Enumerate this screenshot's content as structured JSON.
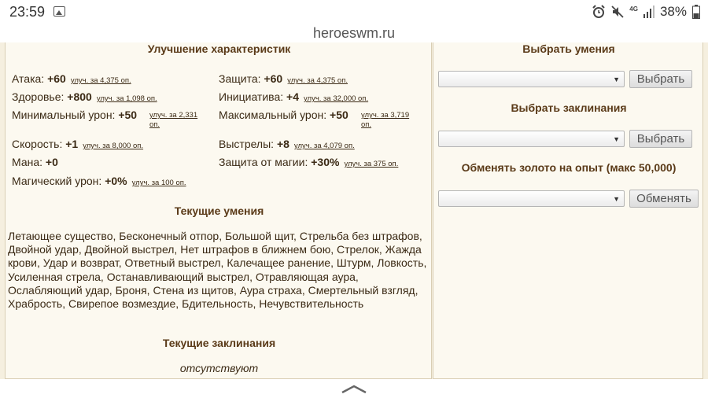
{
  "statusbar": {
    "time": "23:59",
    "battery": "38%",
    "network": "4G",
    "icons": [
      "gallery-icon",
      "alarm-icon",
      "mute-icon",
      "signal-icon",
      "battery-icon"
    ]
  },
  "browser": {
    "url": "heroeswm.ru"
  },
  "left": {
    "stats_heading": "Улучшение характеристик",
    "stats": {
      "attack": {
        "label": "Атака: ",
        "value": "+60",
        "upgrade": "улуч. за 4,375 оп."
      },
      "defense": {
        "label": "Защита: ",
        "value": "+60",
        "upgrade": "улуч. за 4,375 оп."
      },
      "health": {
        "label": "Здоровье: ",
        "value": "+800",
        "upgrade": "улуч. за 1,098 оп."
      },
      "initiative": {
        "label": "Инициатива: ",
        "value": "+4",
        "upgrade": "улуч. за 32,000 оп."
      },
      "min_damage": {
        "label": "Минимальный урон: ",
        "value": "+50",
        "upgrade_line1": "улуч. за 2,331",
        "upgrade_line2": "оп."
      },
      "max_damage": {
        "label": "Максимальный урон: ",
        "value": "+50",
        "upgrade_line1": "улуч. за 3,719",
        "upgrade_line2": "оп."
      },
      "speed": {
        "label": "Скорость: ",
        "value": "+1",
        "upgrade": "улуч. за 8,000 оп."
      },
      "shots": {
        "label": "Выстрелы: ",
        "value": "+8",
        "upgrade": "улуч. за 4,079 оп."
      },
      "mana": {
        "label": "Мана: ",
        "value": "+0"
      },
      "magic_defense": {
        "label": "Защита от магии: ",
        "value": "+30%",
        "upgrade": "улуч. за 375 оп."
      },
      "magic_damage": {
        "label": "Магический урон: ",
        "value": "+0%",
        "upgrade": "улуч. за 100 оп."
      }
    },
    "skills_heading": "Текущие умения",
    "skills_text": "Летающее существо, Бесконечный отпор, Большой щит, Стрельба без штрафов, Двойной удар, Двойной выстрел, Нет штрафов в ближнем бою, Стрелок, Жажда крови, Удар и возврат, Ответный выстрел, Калечащее ранение, Штурм, Ловкость, Усиленная стрела, Останавливающий выстрел, Отравляющая аура, Ослабляющий удар, Броня, Стена из щитов, Аура страха, Смертельный взгляд, Храбрость, Свирепое возмездие, Бдительность, Нечувствительность",
    "spells_heading": "Текущие заклинания",
    "spells_none": "отсутствуют"
  },
  "right": {
    "skills_heading": "Выбрать умения",
    "skills_button": "Выбрать",
    "spells_heading": "Выбрать заклинания",
    "spells_button": "Выбрать",
    "exchange_heading": "Обменять золото на опыт (макс 50,000)",
    "exchange_button": "Обменять",
    "dropdown_arrow": "▼"
  }
}
